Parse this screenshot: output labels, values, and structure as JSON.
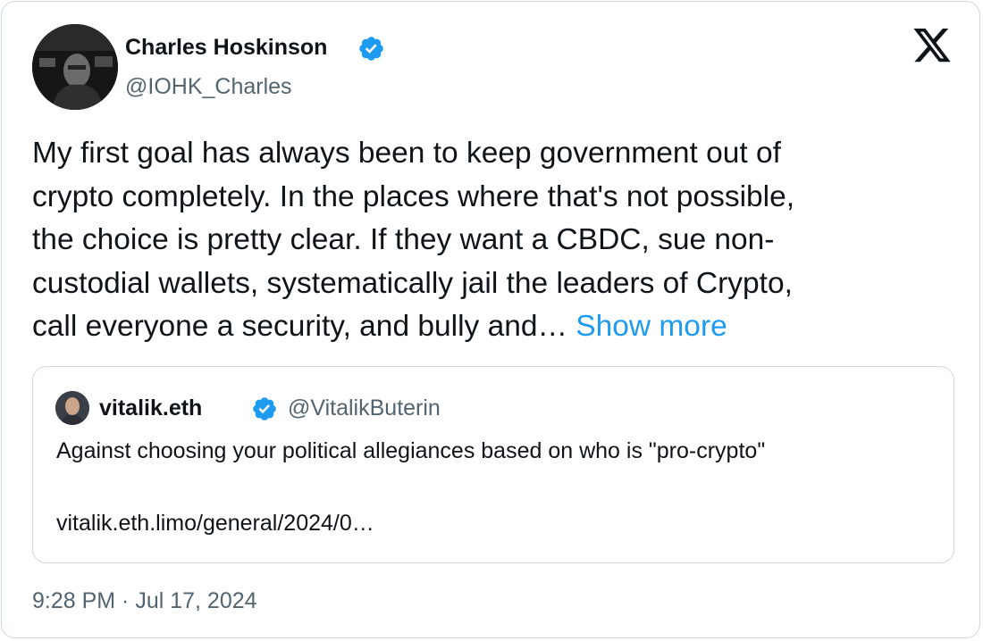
{
  "author": {
    "name": "Charles Hoskinson",
    "handle": "@IOHK_Charles",
    "verified": true
  },
  "tweet": {
    "lines": [
      "My first goal has always been to keep government out of",
      "crypto completely. In the places where that's not possible,",
      "the choice is pretty clear. If they want a CBDC, sue non-",
      "custodial wallets, systematically jail the leaders of Crypto,",
      "call everyone a security, and bully and…"
    ],
    "show_more_label": "Show more"
  },
  "quoted": {
    "name": "vitalik.eth",
    "handle": "@VitalikButerin",
    "verified": true,
    "text": "Against choosing your political allegiances based on who is \"pro-crypto\"",
    "link": "vitalik.eth.limo/general/2024/0…"
  },
  "timestamp": "9:28 PM · Jul 17, 2024",
  "colors": {
    "accent": "#1d9bf0",
    "text": "#0f1419",
    "secondary": "#536471",
    "border": "#cfd9de"
  },
  "icons": {
    "brand": "x-logo-icon",
    "verified": "verified-badge-icon"
  }
}
